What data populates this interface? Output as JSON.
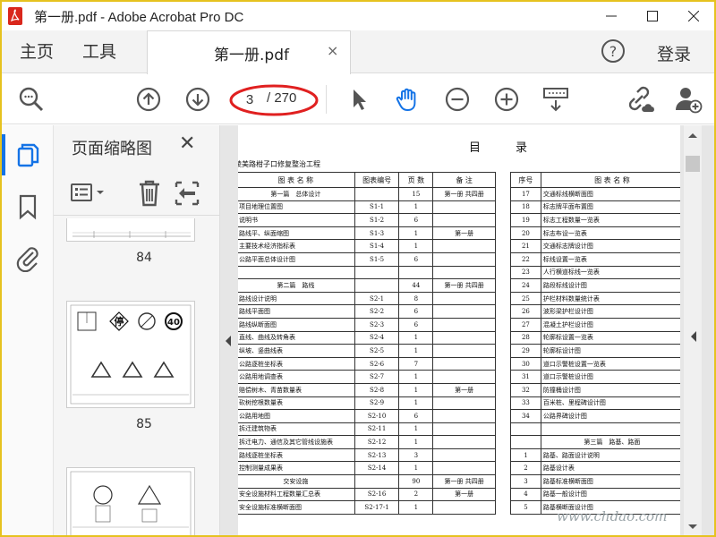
{
  "window": {
    "title": "第一册.pdf - Adobe Acrobat Pro DC"
  },
  "menu": {
    "home": "主页",
    "tools": "工具",
    "login": "登录"
  },
  "tab": {
    "label": "第一册.pdf",
    "close": "×"
  },
  "toolbar": {
    "page_current": "3",
    "page_total": "/ 270"
  },
  "panel": {
    "title": "页面缩略图",
    "close": "✕",
    "thumbnails": [
      {
        "label": "84"
      },
      {
        "label": "85"
      }
    ],
    "sign_stop": "停",
    "sign_speed": "40"
  },
  "doc": {
    "title": "目　　　录",
    "subtitle": "陵美路柑子口修复整治工程",
    "left_header": [
      "图 表 名 称",
      "图表编号",
      "页 数",
      "备 注"
    ],
    "left_rows": [
      [
        "第一篇　总体设计",
        "",
        "15",
        "第一册 共四册"
      ],
      [
        "项目地理位置图",
        "S1-1",
        "1",
        ""
      ],
      [
        "说明书",
        "S1-2",
        "6",
        ""
      ],
      [
        "路线平、纵面缩图",
        "S1-3",
        "1",
        "第一册"
      ],
      [
        "主要技术经济指标表",
        "S1-4",
        "1",
        ""
      ],
      [
        "公路平面总体设计图",
        "S1-5",
        "6",
        ""
      ],
      [
        "",
        "",
        "",
        ""
      ],
      [
        "第二篇　路线",
        "",
        "44",
        "第一册 共四册"
      ],
      [
        "路线设计说明",
        "S2-1",
        "8",
        ""
      ],
      [
        "路线平面图",
        "S2-2",
        "6",
        ""
      ],
      [
        "路线纵断面图",
        "S2-3",
        "6",
        ""
      ],
      [
        "直线、曲线及转角表",
        "S2-4",
        "1",
        ""
      ],
      [
        "纵坡、竖曲线表",
        "S2-5",
        "1",
        ""
      ],
      [
        "公路逐桩坐标表",
        "S2-6",
        "7",
        ""
      ],
      [
        "公路用地调查表",
        "S2-7",
        "1",
        ""
      ],
      [
        "赔偿树木、青苗数量表",
        "S2-8",
        "1",
        "第一册"
      ],
      [
        "砍树挖根数量表",
        "S2-9",
        "1",
        ""
      ],
      [
        "公路用地图",
        "S2-10",
        "6",
        ""
      ],
      [
        "拆迁建筑物表",
        "S2-11",
        "1",
        ""
      ],
      [
        "拆迁电力、通信及其它管线设施表",
        "S2-12",
        "1",
        ""
      ],
      [
        "路线逐桩坐标表",
        "S2-13",
        "3",
        ""
      ],
      [
        "控制测量成果表",
        "S2-14",
        "1",
        ""
      ],
      [
        "交安设施",
        "",
        "90",
        "第一册 共四册"
      ],
      [
        "安全设施材料工程数量汇总表",
        "S2-16",
        "2",
        "第一册"
      ],
      [
        "安全设施标准横断面图",
        "S2-17-1",
        "1",
        ""
      ]
    ],
    "right_header": [
      "序号",
      "图 表 名 称"
    ],
    "right_rows": [
      [
        "17",
        "交通标线横断面图"
      ],
      [
        "18",
        "标志牌平面布置图"
      ],
      [
        "19",
        "标志工程数量一览表"
      ],
      [
        "20",
        "标志布设一览表"
      ],
      [
        "21",
        "交通标志牌设计图"
      ],
      [
        "22",
        "标线设置一览表"
      ],
      [
        "23",
        "人行横道标线一览表"
      ],
      [
        "24",
        "路段标线设计图"
      ],
      [
        "25",
        "护栏材料数量统计表"
      ],
      [
        "26",
        "波形梁护栏设计图"
      ],
      [
        "27",
        "混凝土护栏设计图"
      ],
      [
        "28",
        "轮廓标设置一览表"
      ],
      [
        "29",
        "轮廓标设计图"
      ],
      [
        "30",
        "道口示警桩设置一览表"
      ],
      [
        "31",
        "道口示警桩设计图"
      ],
      [
        "32",
        "防撞桶设计图"
      ],
      [
        "33",
        "百米桩、里程碑设计图"
      ],
      [
        "34",
        "公路界碑设计图"
      ],
      [
        "",
        ""
      ],
      [
        "",
        "第三篇　路基、路面"
      ],
      [
        "1",
        "路基、路面设计说明"
      ],
      [
        "2",
        "路基设计表"
      ],
      [
        "3",
        "路基标准横断面图"
      ],
      [
        "4",
        "路基一般设计图"
      ],
      [
        "5",
        "路基横断面设计图"
      ]
    ]
  },
  "watermark": "www.chdao.com",
  "colors": {
    "accent": "#1473e6",
    "annotation": "#e02020",
    "frame": "#e6c21f"
  }
}
